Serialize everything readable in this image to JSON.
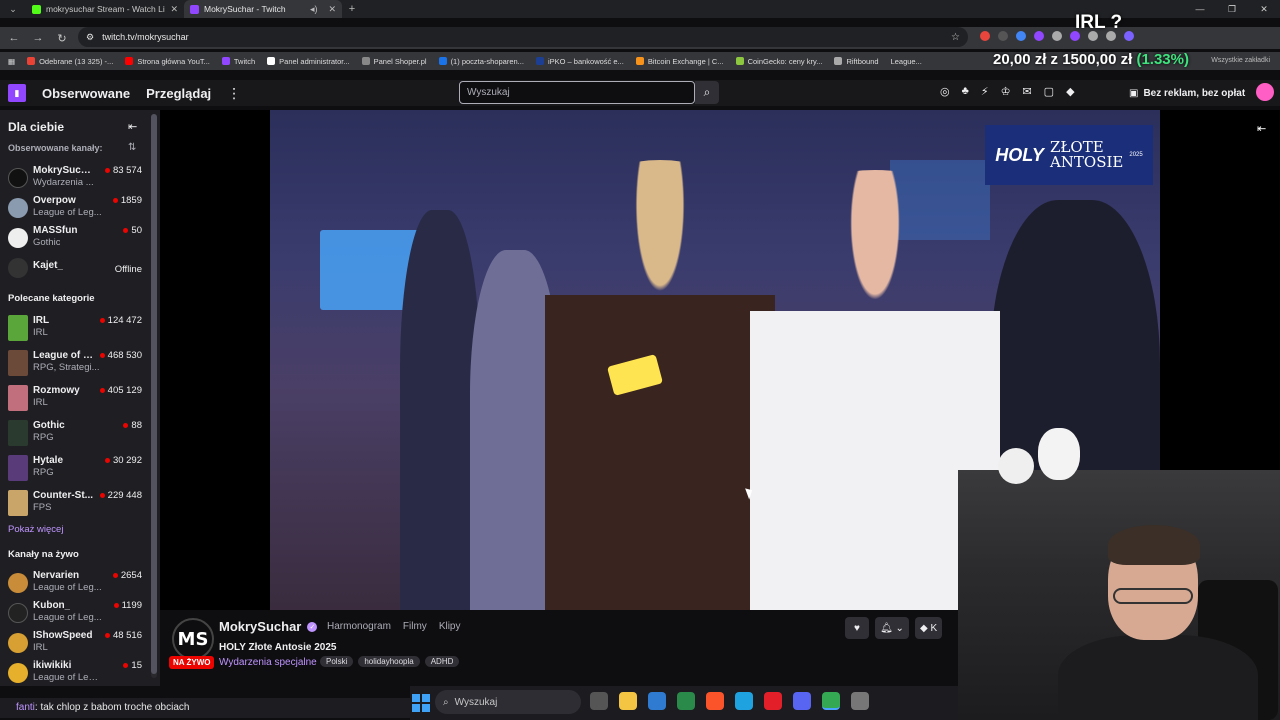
{
  "browser": {
    "tabs": [
      {
        "title": "mokrysuchar Stream - Watch Li",
        "active": false
      },
      {
        "title": "MokrySuchar - Twitch",
        "active": true
      }
    ],
    "url": "twitch.tv/mokrysuchar",
    "bookmarks": [
      "Odebrane (13 325) -...",
      "Strona główna YouT...",
      "Twitch",
      "Panel administrator...",
      "Panel Shoper.pl",
      "(1) poczta-shoparen...",
      "iPKO – bankowość e...",
      "Bitcoin Exchange | C...",
      "CoinGecko: ceny kry...",
      "Riftbound",
      "League..."
    ],
    "all_bookmarks": "Wszystkie zakładki"
  },
  "overlay": {
    "irl": "IRL ?",
    "amount_left": "20,00 zł",
    "amount_sep": "z",
    "amount_right": "1500,00 zł",
    "percent": "(1.33%)"
  },
  "nav": {
    "following": "Obserwowane",
    "browse": "Przeglądaj",
    "search_placeholder": "Wyszukaj",
    "adfree": "Bez reklam, bez opłat"
  },
  "sidebar": {
    "title": "Dla ciebie",
    "followed_label": "Obserwowane kanały:",
    "followed": [
      {
        "name": "MokrySuchar",
        "game": "Wydarzenia ...",
        "viewers": "83 574",
        "live": true
      },
      {
        "name": "Overpow",
        "game": "League of Leg...",
        "viewers": "1859",
        "live": true
      },
      {
        "name": "MASSfun",
        "game": "Gothic",
        "viewers": "50",
        "live": true
      },
      {
        "name": "Kajet_",
        "game": "",
        "viewers": "Offline",
        "live": false
      }
    ],
    "recommended_label": "Polecane kategorie",
    "categories": [
      {
        "name": "IRL",
        "sub": "IRL",
        "viewers": "124 472"
      },
      {
        "name": "League of L...",
        "sub": "RPG, Strategi...",
        "viewers": "468 530"
      },
      {
        "name": "Rozmowy",
        "sub": "IRL",
        "viewers": "405 129"
      },
      {
        "name": "Gothic",
        "sub": "RPG",
        "viewers": "88"
      },
      {
        "name": "Hytale",
        "sub": "RPG",
        "viewers": "30 292"
      },
      {
        "name": "Counter-St...",
        "sub": "FPS",
        "viewers": "229 448"
      }
    ],
    "show_more": "Pokaż więcej",
    "live_label": "Kanały na żywo",
    "live": [
      {
        "name": "Nervarien",
        "game": "League of Leg...",
        "viewers": "2654"
      },
      {
        "name": "Kubon_",
        "game": "League of Leg...",
        "viewers": "1199"
      },
      {
        "name": "IShowSpeed",
        "game": "IRL",
        "viewers": "48 516"
      },
      {
        "name": "ikiwikiki",
        "game": "League of Lege...",
        "viewers": "15"
      }
    ]
  },
  "player": {
    "logo_holy": "HOLY",
    "logo_zlote": "ZŁOTE",
    "logo_antosie": "ANTOSIE",
    "logo_year": "2025"
  },
  "channel": {
    "avatar_text": "MS",
    "live_badge": "NA ŻYWO",
    "name": "MokrySuchar",
    "tabs": [
      "Harmonogram",
      "Filmy",
      "Klipy"
    ],
    "title": "HOLY Złote Antosie 2025",
    "category": "Wydarzenia specjalne",
    "tags": [
      "Polski",
      "holidayhoopla",
      "ADHD"
    ]
  },
  "chat": {
    "user": "fanti",
    "message": ": tak chlop z babom troche obciach"
  },
  "taskbar": {
    "search_placeholder": "Wyszukaj"
  },
  "colors": {
    "twitch_purple": "#9147ff",
    "live_red": "#eb0400",
    "link_purple": "#bf94ff",
    "overlay_green": "#3ee37d"
  }
}
